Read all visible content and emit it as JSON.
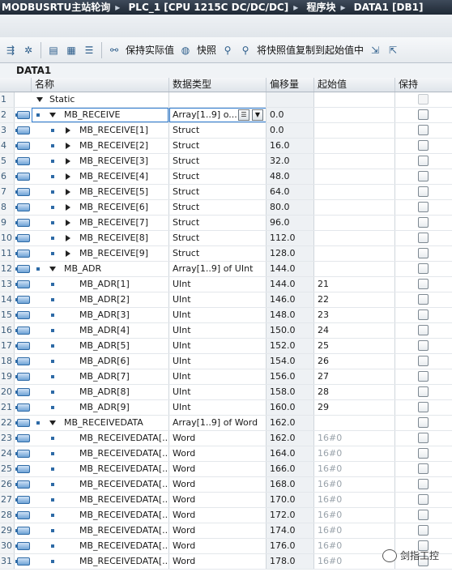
{
  "breadcrumb": [
    "MODBUSRTU主站轮询",
    "PLC_1 [CPU 1215C DC/DC/DC]",
    "程序块",
    "DATA1 [DB1]"
  ],
  "toolbar": {
    "keep_actual": "保持实际值",
    "snapshot": "快照",
    "copy_snapshot": "将快照值复制到起始值中"
  },
  "db_title": "DATA1",
  "columns": {
    "name": "名称",
    "type": "数据类型",
    "offset": "偏移量",
    "start": "起始值",
    "retain": "保持"
  },
  "rows": [
    {
      "num": "1",
      "name": "Static",
      "type": "",
      "offset": "",
      "start": "",
      "level": 0,
      "expand": "down",
      "bullet": false,
      "icon": false
    },
    {
      "num": "2",
      "name": "MB_RECEIVE",
      "type": "Array[1..9] o...",
      "offset": "0.0",
      "start": "",
      "level": 1,
      "expand": "down",
      "bullet": true,
      "icon": true,
      "selected": true
    },
    {
      "num": "3",
      "name": "MB_RECEIVE[1]",
      "type": "Struct",
      "offset": "0.0",
      "start": "",
      "level": 2,
      "expand": "right",
      "bullet": true,
      "icon": true
    },
    {
      "num": "4",
      "name": "MB_RECEIVE[2]",
      "type": "Struct",
      "offset": "16.0",
      "start": "",
      "level": 2,
      "expand": "right",
      "bullet": true,
      "icon": true
    },
    {
      "num": "5",
      "name": "MB_RECEIVE[3]",
      "type": "Struct",
      "offset": "32.0",
      "start": "",
      "level": 2,
      "expand": "right",
      "bullet": true,
      "icon": true
    },
    {
      "num": "6",
      "name": "MB_RECEIVE[4]",
      "type": "Struct",
      "offset": "48.0",
      "start": "",
      "level": 2,
      "expand": "right",
      "bullet": true,
      "icon": true
    },
    {
      "num": "7",
      "name": "MB_RECEIVE[5]",
      "type": "Struct",
      "offset": "64.0",
      "start": "",
      "level": 2,
      "expand": "right",
      "bullet": true,
      "icon": true
    },
    {
      "num": "8",
      "name": "MB_RECEIVE[6]",
      "type": "Struct",
      "offset": "80.0",
      "start": "",
      "level": 2,
      "expand": "right",
      "bullet": true,
      "icon": true
    },
    {
      "num": "9",
      "name": "MB_RECEIVE[7]",
      "type": "Struct",
      "offset": "96.0",
      "start": "",
      "level": 2,
      "expand": "right",
      "bullet": true,
      "icon": true
    },
    {
      "num": "10",
      "name": "MB_RECEIVE[8]",
      "type": "Struct",
      "offset": "112.0",
      "start": "",
      "level": 2,
      "expand": "right",
      "bullet": true,
      "icon": true
    },
    {
      "num": "11",
      "name": "MB_RECEIVE[9]",
      "type": "Struct",
      "offset": "128.0",
      "start": "",
      "level": 2,
      "expand": "right",
      "bullet": true,
      "icon": true
    },
    {
      "num": "12",
      "name": "MB_ADR",
      "type": "Array[1..9] of UInt",
      "offset": "144.0",
      "start": "",
      "level": 1,
      "expand": "down",
      "bullet": true,
      "icon": true
    },
    {
      "num": "13",
      "name": "MB_ADR[1]",
      "type": "UInt",
      "offset": "144.0",
      "start": "21",
      "level": 2,
      "expand": "",
      "bullet": true,
      "icon": true
    },
    {
      "num": "14",
      "name": "MB_ADR[2]",
      "type": "UInt",
      "offset": "146.0",
      "start": "22",
      "level": 2,
      "expand": "",
      "bullet": true,
      "icon": true
    },
    {
      "num": "15",
      "name": "MB_ADR[3]",
      "type": "UInt",
      "offset": "148.0",
      "start": "23",
      "level": 2,
      "expand": "",
      "bullet": true,
      "icon": true
    },
    {
      "num": "16",
      "name": "MB_ADR[4]",
      "type": "UInt",
      "offset": "150.0",
      "start": "24",
      "level": 2,
      "expand": "",
      "bullet": true,
      "icon": true
    },
    {
      "num": "17",
      "name": "MB_ADR[5]",
      "type": "UInt",
      "offset": "152.0",
      "start": "25",
      "level": 2,
      "expand": "",
      "bullet": true,
      "icon": true
    },
    {
      "num": "18",
      "name": "MB_ADR[6]",
      "type": "UInt",
      "offset": "154.0",
      "start": "26",
      "level": 2,
      "expand": "",
      "bullet": true,
      "icon": true
    },
    {
      "num": "19",
      "name": "MB_ADR[7]",
      "type": "UInt",
      "offset": "156.0",
      "start": "27",
      "level": 2,
      "expand": "",
      "bullet": true,
      "icon": true
    },
    {
      "num": "20",
      "name": "MB_ADR[8]",
      "type": "UInt",
      "offset": "158.0",
      "start": "28",
      "level": 2,
      "expand": "",
      "bullet": true,
      "icon": true
    },
    {
      "num": "21",
      "name": "MB_ADR[9]",
      "type": "UInt",
      "offset": "160.0",
      "start": "29",
      "level": 2,
      "expand": "",
      "bullet": true,
      "icon": true
    },
    {
      "num": "22",
      "name": "MB_RECEIVEDATA",
      "type": "Array[1..9] of Word",
      "offset": "162.0",
      "start": "",
      "level": 1,
      "expand": "down",
      "bullet": true,
      "icon": true
    },
    {
      "num": "23",
      "name": "MB_RECEIVEDATA[...",
      "type": "Word",
      "offset": "162.0",
      "start": "16#0",
      "level": 2,
      "expand": "",
      "bullet": true,
      "icon": true,
      "startGray": true
    },
    {
      "num": "24",
      "name": "MB_RECEIVEDATA[...",
      "type": "Word",
      "offset": "164.0",
      "start": "16#0",
      "level": 2,
      "expand": "",
      "bullet": true,
      "icon": true,
      "startGray": true
    },
    {
      "num": "25",
      "name": "MB_RECEIVEDATA[...",
      "type": "Word",
      "offset": "166.0",
      "start": "16#0",
      "level": 2,
      "expand": "",
      "bullet": true,
      "icon": true,
      "startGray": true
    },
    {
      "num": "26",
      "name": "MB_RECEIVEDATA[...",
      "type": "Word",
      "offset": "168.0",
      "start": "16#0",
      "level": 2,
      "expand": "",
      "bullet": true,
      "icon": true,
      "startGray": true
    },
    {
      "num": "27",
      "name": "MB_RECEIVEDATA[...",
      "type": "Word",
      "offset": "170.0",
      "start": "16#0",
      "level": 2,
      "expand": "",
      "bullet": true,
      "icon": true,
      "startGray": true
    },
    {
      "num": "28",
      "name": "MB_RECEIVEDATA[...",
      "type": "Word",
      "offset": "172.0",
      "start": "16#0",
      "level": 2,
      "expand": "",
      "bullet": true,
      "icon": true,
      "startGray": true
    },
    {
      "num": "29",
      "name": "MB_RECEIVEDATA[...",
      "type": "Word",
      "offset": "174.0",
      "start": "16#0",
      "level": 2,
      "expand": "",
      "bullet": true,
      "icon": true,
      "startGray": true
    },
    {
      "num": "30",
      "name": "MB_RECEIVEDATA[...",
      "type": "Word",
      "offset": "176.0",
      "start": "16#0",
      "level": 2,
      "expand": "",
      "bullet": true,
      "icon": true,
      "startGray": true
    },
    {
      "num": "31",
      "name": "MB_RECEIVEDATA[...",
      "type": "Word",
      "offset": "178.0",
      "start": "16#0",
      "level": 2,
      "expand": "",
      "bullet": true,
      "icon": true,
      "startGray": true
    }
  ],
  "watermark": "剑指工控"
}
